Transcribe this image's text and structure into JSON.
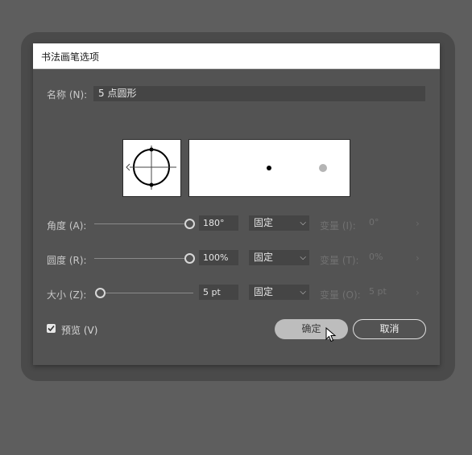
{
  "dialog": {
    "title": "书法画笔选项",
    "name_label": "名称 (N):",
    "name_value": "5 点圆形"
  },
  "rows": [
    {
      "label": "角度 (A):",
      "value": "180°",
      "mode": "固定",
      "variation_label": "变量 (I):",
      "variation_value": "0°",
      "slider_level": 1.0
    },
    {
      "label": "圆度 (R):",
      "value": "100%",
      "mode": "固定",
      "variation_label": "变量 (T):",
      "variation_value": "0%",
      "slider_level": 1.0
    },
    {
      "label": "大小 (Z):",
      "value": "5 pt",
      "mode": "固定",
      "variation_label": "变量 (O):",
      "variation_value": "5 pt",
      "slider_level": 0.0
    }
  ],
  "footer": {
    "preview_label": "预览 (V)",
    "preview_checked": true,
    "ok_label": "确定",
    "cancel_label": "取消"
  },
  "icons": {
    "chevron": "chevron-down-icon",
    "arrow": "chevron-right-icon",
    "check": "check-icon",
    "cursor": "mouse-pointer-icon"
  }
}
